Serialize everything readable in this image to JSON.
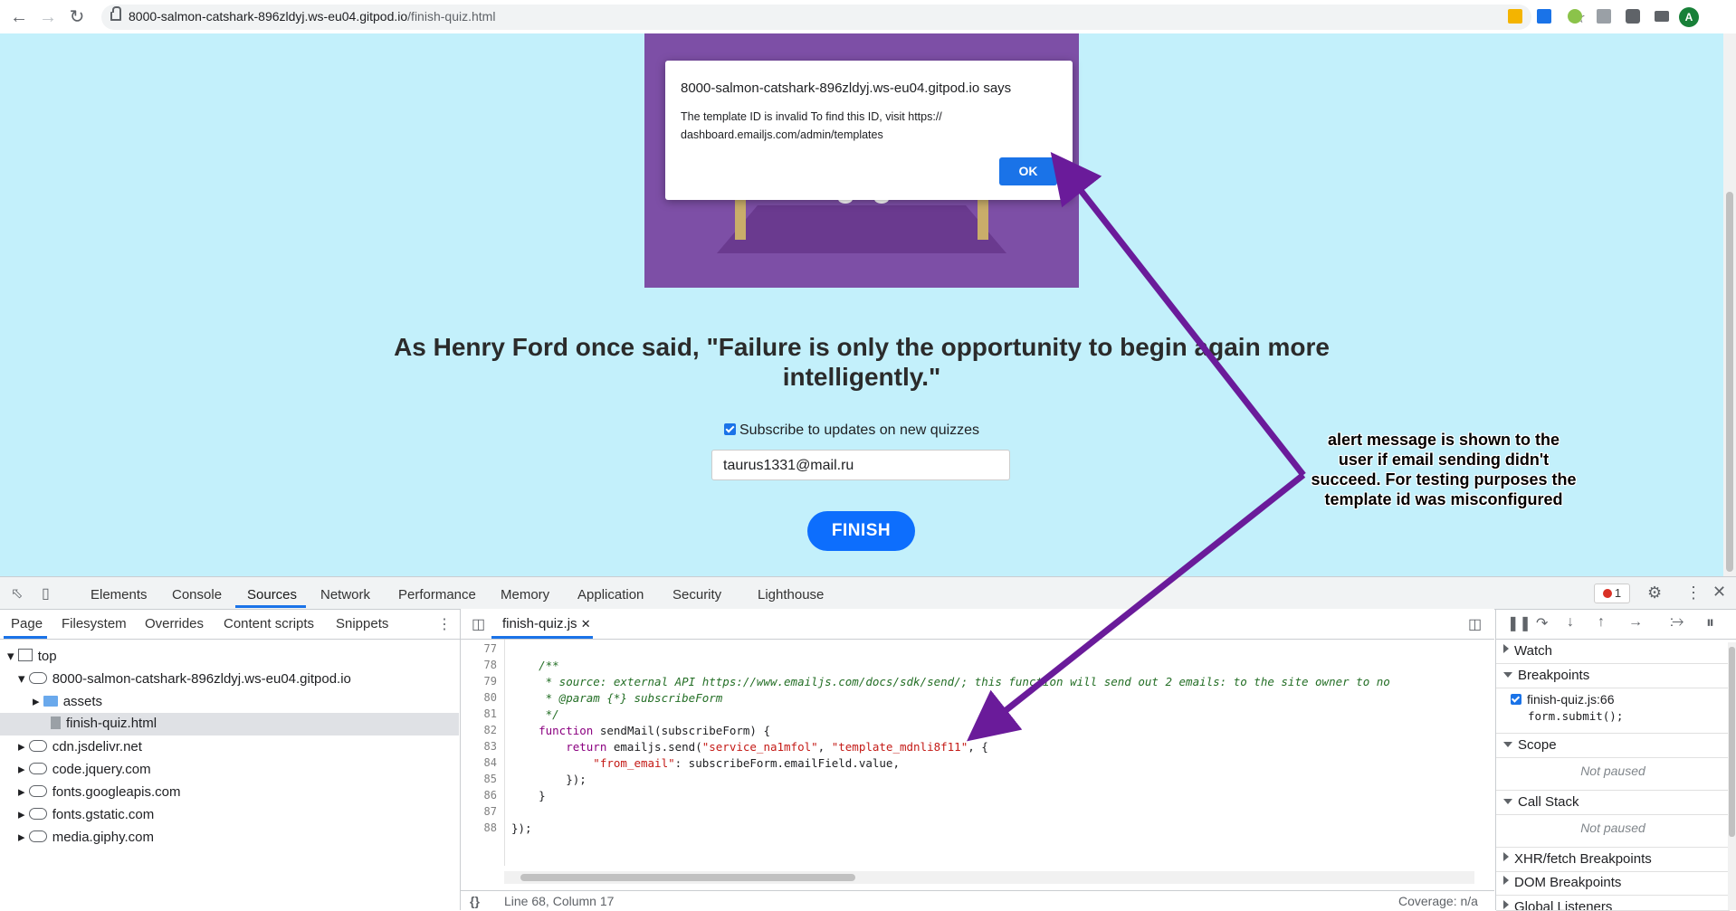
{
  "browser": {
    "url_host": "8000-salmon-catshark-896zldyj.ws-eu04.gitpod.io",
    "url_path": "/finish-quiz.html",
    "avatar_letter": "A"
  },
  "page": {
    "quote_line1": "As Henry Ford once said, \"Failure is only the opportunity to begin again more",
    "quote_line2": "intelligently.\"",
    "subscribe_label": "Subscribe to updates on new quizzes",
    "subscribe_checked": true,
    "email_value": "taurus1331@mail.ru",
    "finish_label": "FINISH",
    "colors": {
      "background": "#c3f0fb",
      "accent": "#0d6efd",
      "image": "#7d4fa6"
    }
  },
  "dialog": {
    "title": "8000-salmon-catshark-896zldyj.ws-eu04.gitpod.io says",
    "message_line1": "The template ID is invalid To find this ID, visit https://",
    "message_line2": "dashboard.emailjs.com/admin/templates",
    "ok_label": "OK"
  },
  "devtools": {
    "tabs": [
      "Elements",
      "Console",
      "Sources",
      "Network",
      "Performance",
      "Memory",
      "Application",
      "Security",
      "Lighthouse"
    ],
    "active_tab": "Sources",
    "error_count": "1",
    "nav_tabs": [
      "Page",
      "Filesystem",
      "Overrides",
      "Content scripts",
      "Snippets"
    ],
    "tree": {
      "top": "top",
      "origin": "8000-salmon-catshark-896zldyj.ws-eu04.gitpod.io",
      "assets": "assets",
      "file": "finish-quiz.html",
      "domains": [
        "cdn.jsdelivr.net",
        "code.jquery.com",
        "fonts.googleapis.com",
        "fonts.gstatic.com",
        "media.giphy.com"
      ]
    },
    "open_file": "finish-quiz.js",
    "line_numbers": [
      "77",
      "78",
      "79",
      "80",
      "81",
      "82",
      "83",
      "84",
      "85",
      "86",
      "87",
      "88"
    ],
    "code": {
      "l78": "    /**",
      "l79": "     * source: external API https://www.emailjs.com/docs/sdk/send/; this function will send out 2 emails: to the site owner to no",
      "l80": "     * @param {*} subscribeForm",
      "l81": "     */",
      "l82_kw": "function",
      "l82_rest": " sendMail(subscribeForm) {",
      "l83_a": "        return",
      "l83_b": " emailjs.send(",
      "l83_s1": "\"service_na1mfol\"",
      "l83_c": ", ",
      "l83_s2": "\"template_mdnli8f11\"",
      "l83_d": ", {",
      "l84_s": "            \"from_email\"",
      "l84_rest": ": subscribeForm.emailField.value,",
      "l85": "        });",
      "l86": "    }",
      "l88": "});"
    },
    "status": {
      "position": "Line 68, Column 17",
      "coverage": "Coverage: n/a"
    },
    "debugger": {
      "watch": "Watch",
      "breakpoints": "Breakpoints",
      "bp_file": "finish-quiz.js:66",
      "bp_code": "form.submit();",
      "scope": "Scope",
      "scope_state": "Not paused",
      "call_stack": "Call Stack",
      "call_state": "Not paused",
      "xhr": "XHR/fetch Breakpoints",
      "dom": "DOM Breakpoints",
      "global": "Global Listeners"
    }
  },
  "annotation": {
    "line1": "alert message is shown to the",
    "line2": "user if email sending didn't",
    "line3": "succeed. For testing purposes the",
    "line4": "template id was misconfigured",
    "color": "#6a1b9a"
  }
}
